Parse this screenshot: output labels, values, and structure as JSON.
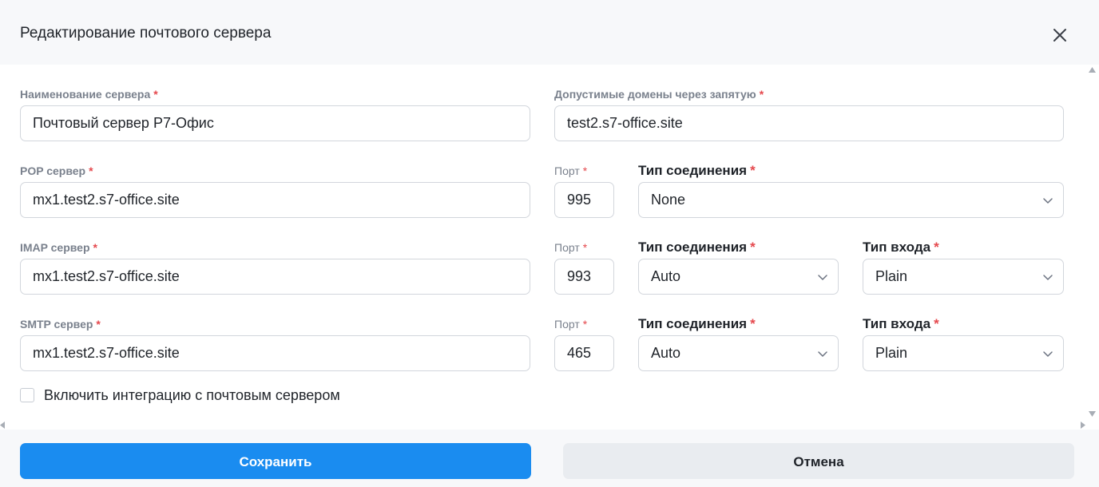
{
  "dialog": {
    "title": "Редактирование почтового сервера",
    "close_icon": "close-icon"
  },
  "server_name": {
    "label": "Наименование сервера",
    "required": "*",
    "value": "Почтовый сервер Р7-Офис"
  },
  "domains": {
    "label": "Допустимые домены через запятую",
    "required": "*",
    "value": "test2.s7-office.site"
  },
  "pop": {
    "label": "POP сервер",
    "required": "*",
    "value": "mx1.test2.s7-office.site",
    "port_label": "Порт",
    "port": "995",
    "connection_label": "Тип соединения",
    "connection": "None"
  },
  "imap": {
    "label": "IMAP сервер",
    "required": "*",
    "value": "mx1.test2.s7-office.site",
    "port_label": "Порт",
    "port": "993",
    "connection_label": "Тип соединения",
    "connection": "Auto",
    "login_label": "Тип входа",
    "login": "Plain"
  },
  "smtp": {
    "label": "SMTP сервер",
    "required": "*",
    "value": "mx1.test2.s7-office.site",
    "port_label": "Порт",
    "port": "465",
    "connection_label": "Тип соединения",
    "connection": "Auto",
    "login_label": "Тип входа",
    "login": "Plain"
  },
  "integration": {
    "label": "Включить интеграцию с почтовым сервером",
    "checked": false
  },
  "buttons": {
    "save": "Сохранить",
    "cancel": "Отмена"
  },
  "colors": {
    "primary": "#1a8cf0",
    "required": "#e5484d",
    "header_bg": "#f7f8fa",
    "border": "#d2d6dc"
  }
}
